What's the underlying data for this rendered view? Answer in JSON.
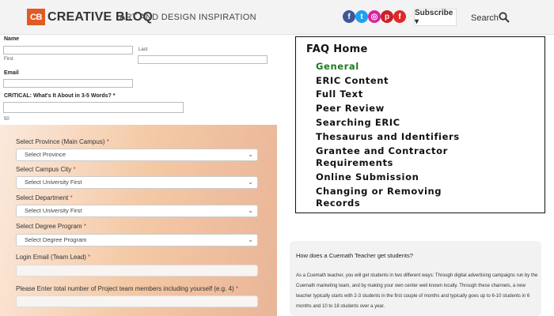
{
  "header": {
    "logo_badge": "CB",
    "logo_text": "CREATIVE BLOQ",
    "tagline": "ART AND DESIGN INSPIRATION",
    "subscribe_label": "Subscribe ▾",
    "search_label": "Search",
    "socials": [
      {
        "name": "facebook",
        "glyph": "f",
        "color": "#3b5998"
      },
      {
        "name": "twitter",
        "glyph": "t",
        "color": "#1da1f2"
      },
      {
        "name": "instagram",
        "glyph": "◎",
        "color": "#d6249f"
      },
      {
        "name": "pinterest",
        "glyph": "p",
        "color": "#cb2027"
      },
      {
        "name": "flipboard",
        "glyph": "f",
        "color": "#e12828"
      }
    ]
  },
  "name_form": {
    "name_label": "Name",
    "first_label": "First",
    "last_label": "Last",
    "email_label": "Email",
    "critical_label": "CRITICAL: What's It About in 3-5 Words? *",
    "char_count": "50"
  },
  "campus_form": {
    "province_label": "Select Province (Main Campus)",
    "province_value": "Select Province",
    "city_label": "Select Campus City",
    "city_value": "Select University First",
    "department_label": "Select Department",
    "department_value": "Select University First",
    "degree_label": "Select Degree Program",
    "degree_value": "Select Degree Program",
    "login_label": "Login Email (Team Lead)",
    "members_label": "Please Enter total number of Project team members including yourself (e.g. 4)",
    "required_mark": "*"
  },
  "faq": {
    "title": "FAQ Home",
    "items": [
      "General",
      "ERIC Content",
      "Full Text",
      "Peer Review",
      "Searching ERIC",
      "Thesaurus and Identifiers",
      "Grantee and Contractor",
      "Requirements",
      "Online Submission",
      "Changing or Removing",
      "Records"
    ],
    "active_color": "#1f7a1f"
  },
  "card": {
    "question": "How does a Cuemath Teacher get students?",
    "answer": "As a Cuemath teacher, you will get students in two different ways: Through digital advertising campaigns run by the Cuemath marketing team, and by making your own center well known locally. Through these channels, a new teacher typically starts with 2-3 students in the first couple of months and typically goes up to 6-10 students in 6 months and 10 to 18 students over a year."
  }
}
